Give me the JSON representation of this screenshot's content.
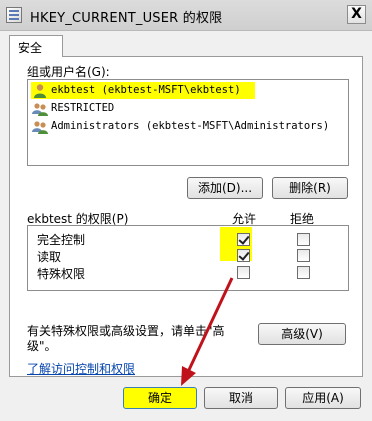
{
  "window": {
    "title": "HKEY_CURRENT_USER 的权限",
    "close_label": "X"
  },
  "tabs": [
    {
      "label": "安全"
    }
  ],
  "groups": {
    "label": "组或用户名(G):",
    "items": [
      {
        "icon": "single-user-icon",
        "name": "ekbtest (ekbtest-MSFT\\ekbtest)",
        "selected": true
      },
      {
        "icon": "user-group-icon",
        "name": "RESTRICTED",
        "selected": false
      },
      {
        "icon": "user-group-icon",
        "name": "Administrators (ekbtest-MSFT\\Administrators)",
        "selected": false
      }
    ]
  },
  "buttons": {
    "add": "添加(D)...",
    "remove": "删除(R)",
    "advanced": "高级(V)",
    "ok": "确定",
    "cancel": "取消",
    "apply": "应用(A)"
  },
  "permissions": {
    "label": "ekbtest 的权限(P)",
    "allow_header": "允许",
    "deny_header": "拒绝",
    "rows": [
      {
        "name": "完全控制",
        "allow": true,
        "deny": false
      },
      {
        "name": "读取",
        "allow": true,
        "deny": false
      },
      {
        "name": "特殊权限",
        "allow": false,
        "deny": false
      }
    ]
  },
  "advanced_hint": {
    "line1": "有关特殊权限或高级设置，请单击\"高",
    "line2": "级\"。"
  },
  "link": "了解访问控制和权限",
  "colors": {
    "highlight": "#ffff00",
    "arrow": "#c0121a"
  }
}
